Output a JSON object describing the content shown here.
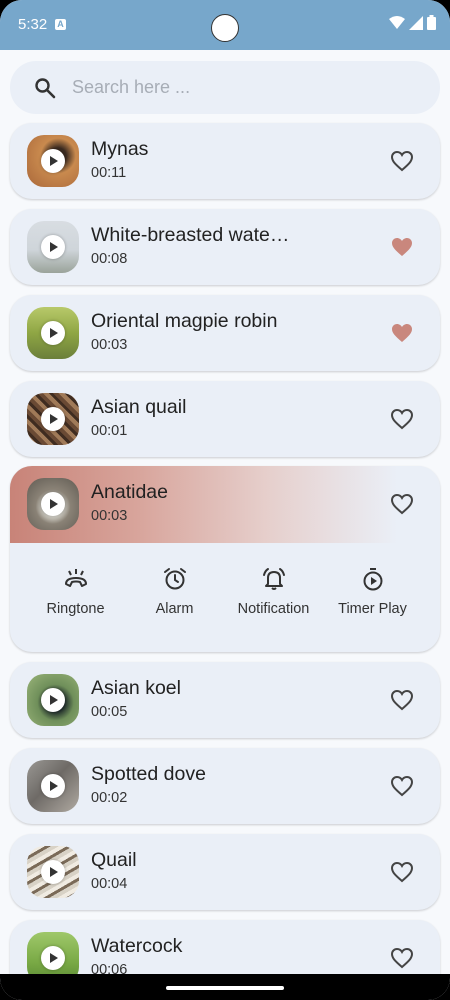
{
  "status": {
    "time": "5:32",
    "a_badge": "A"
  },
  "search": {
    "placeholder": "Search here ..."
  },
  "items": [
    {
      "title": "Mynas",
      "duration": "00:11",
      "favorite": false
    },
    {
      "title": "White-breasted wate…",
      "duration": "00:08",
      "favorite": true
    },
    {
      "title": "Oriental magpie robin",
      "duration": "00:03",
      "favorite": true
    },
    {
      "title": "Asian quail",
      "duration": "00:01",
      "favorite": false
    },
    {
      "title": "Anatidae",
      "duration": "00:03",
      "favorite": false
    },
    {
      "title": "Asian koel",
      "duration": "00:05",
      "favorite": false
    },
    {
      "title": "Spotted dove",
      "duration": "00:02",
      "favorite": false
    },
    {
      "title": "Quail",
      "duration": "00:04",
      "favorite": false
    },
    {
      "title": "Watercock",
      "duration": "00:06",
      "favorite": false
    }
  ],
  "actions": [
    {
      "label": "Ringtone",
      "icon": "ringtone-icon"
    },
    {
      "label": "Alarm",
      "icon": "alarm-icon"
    },
    {
      "label": "Notification",
      "icon": "notification-icon"
    },
    {
      "label": "Timer Play",
      "icon": "timer-play-icon"
    }
  ],
  "colors": {
    "statusbar": "#77a7cb",
    "card": "#eaeff7",
    "heart_filled": "#c9877d",
    "heart_outline": "#444444",
    "expanded_accent": "#c88378"
  }
}
